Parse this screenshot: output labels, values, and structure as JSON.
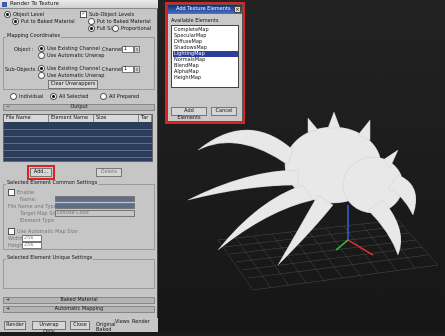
{
  "rtt": {
    "title": "Render To Texture",
    "object_level": "Object Level",
    "sub_object_levels": "Sub-Object Levels",
    "put_to_baked_material": "Put to Baked Material",
    "put_to_baked_material2": "Put to Baked Material",
    "full_size": "Full Size",
    "proportional": "Proportional",
    "mapping_coords_label": "Mapping Coordinates",
    "object_label": "Object :",
    "use_existing_channel": "Use Existing Channel",
    "use_automatic_unwrap": "Use Automatic Unwrap",
    "channel_label": "Channel",
    "channel_value": "1",
    "sub_objects_label": "Sub-Objects :",
    "use_existing_channel2": "Use Existing Channel",
    "use_automatic_unwrap2": "Use Automatic Unwrap",
    "channel_label2": "Channel",
    "channel_value2": "1",
    "clear_unwrappers": "Clear Unwrappers",
    "individual": "Individual",
    "all_selected": "All Selected",
    "all_prepared": "All Prepared",
    "output_rollout": "Output",
    "columns": [
      "File Name",
      "Element Name",
      "Size",
      "Tar"
    ],
    "add_button": "Add...",
    "delete_button": "Delete",
    "common_settings_label": "Selected Element Common Settings",
    "enable_label": "Enable",
    "name_label": "Name:",
    "file_name_type_label": "File Name and Type:",
    "target_map_slot_label": "Target Map Slot:",
    "target_map_slot_value": "Diffuse Color",
    "element_type_label": "Element Type:",
    "use_auto_map_size": "Use Automatic Map Size",
    "width_label": "Width:",
    "height_label": "Height:",
    "size_value": "256",
    "unique_settings_label": "Selected Element Unique Settings",
    "baked_material_rollout": "Baked Material",
    "automatic_mapping_rollout": "Automatic Mapping",
    "bottom_buttons": [
      "Render",
      "Unwrap Only",
      "Close"
    ],
    "original_label": "Original",
    "baked_label": "Baked",
    "views_label": "Views",
    "render_label": "Render"
  },
  "dialog": {
    "title": "Add Texture Elements",
    "available_label": "Available Elements",
    "items": [
      "CompleteMap",
      "SpecularMap",
      "DiffuseMap",
      "ShadowsMap",
      "LightingMap",
      "NormalsMap",
      "BlendMap",
      "AlphaMap",
      "HeightMap"
    ],
    "selected_index": 4,
    "add_elements_button": "Add Elements",
    "cancel_button": "Cancel"
  },
  "colors": {
    "panel_bg": "#c6c6c6",
    "highlight_red": "#d22222",
    "selection_blue": "#2a3e9a",
    "table_bg": "#2c3d5c",
    "viewport_bg": "#1a1a1a"
  }
}
